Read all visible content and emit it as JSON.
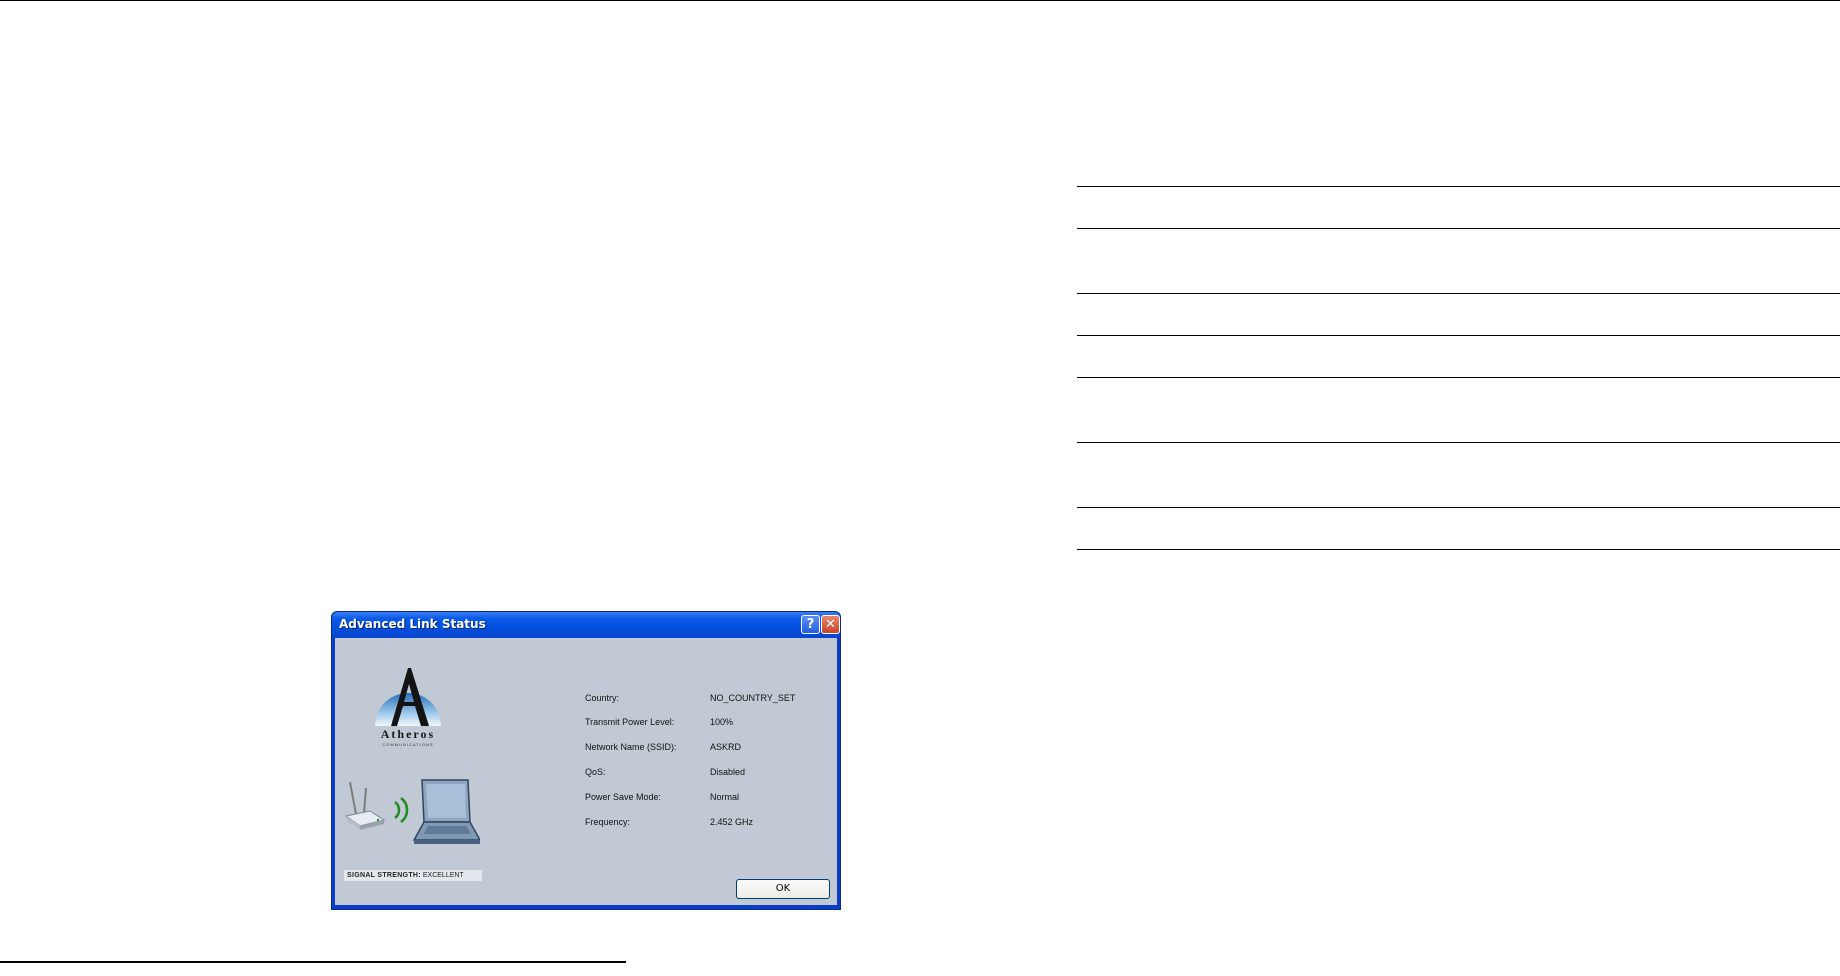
{
  "dialog": {
    "title": "Advanced Link Status",
    "help_label": "?",
    "close_label": "✕",
    "logo": {
      "word": "Atheros",
      "sub": "COMMUNICATIONS"
    },
    "signal": {
      "label": "SIGNAL STRENGTH:",
      "value": "EXCELLENT"
    },
    "info": [
      {
        "label": "Country:",
        "value": "NO_COUNTRY_SET"
      },
      {
        "label": "Transmit Power Level:",
        "value": "100%"
      },
      {
        "label": "Network Name (SSID):",
        "value": "ASKRD"
      },
      {
        "label": "QoS:",
        "value": "Disabled"
      },
      {
        "label": "Power Save Mode:",
        "value": "Normal"
      },
      {
        "label": "Frequency:",
        "value": "2.452 GHz"
      }
    ],
    "ok_label": "OK"
  },
  "colors": {
    "titlebar": "#0350e0",
    "client_bg": "#c1c9d4",
    "signal_arc": "#1e8c1e"
  },
  "icons": [
    "atheros-logo-icon",
    "access-point-icon",
    "signal-waves-icon",
    "laptop-icon",
    "help-icon",
    "close-icon"
  ]
}
